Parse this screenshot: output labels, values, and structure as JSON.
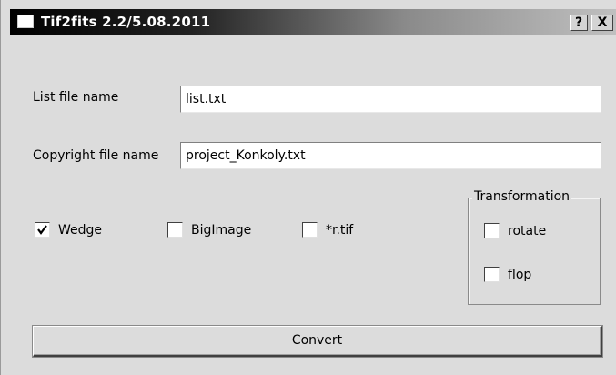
{
  "window": {
    "title": "Tif2fits 2.2/5.08.2011",
    "help_label": "?",
    "close_label": "X"
  },
  "form": {
    "list_label": "List file name",
    "list_value": "list.txt",
    "copyright_label": "Copyright file name",
    "copyright_value": "project_Konkoly.txt"
  },
  "options": [
    {
      "label": "Wedge",
      "checked": true
    },
    {
      "label": "BigImage",
      "checked": false
    },
    {
      "label": "*r.tif",
      "checked": false
    }
  ],
  "transformation": {
    "title": "Transformation",
    "items": [
      {
        "label": "rotate",
        "checked": false
      },
      {
        "label": "flop",
        "checked": false
      }
    ]
  },
  "convert_label": "Convert"
}
